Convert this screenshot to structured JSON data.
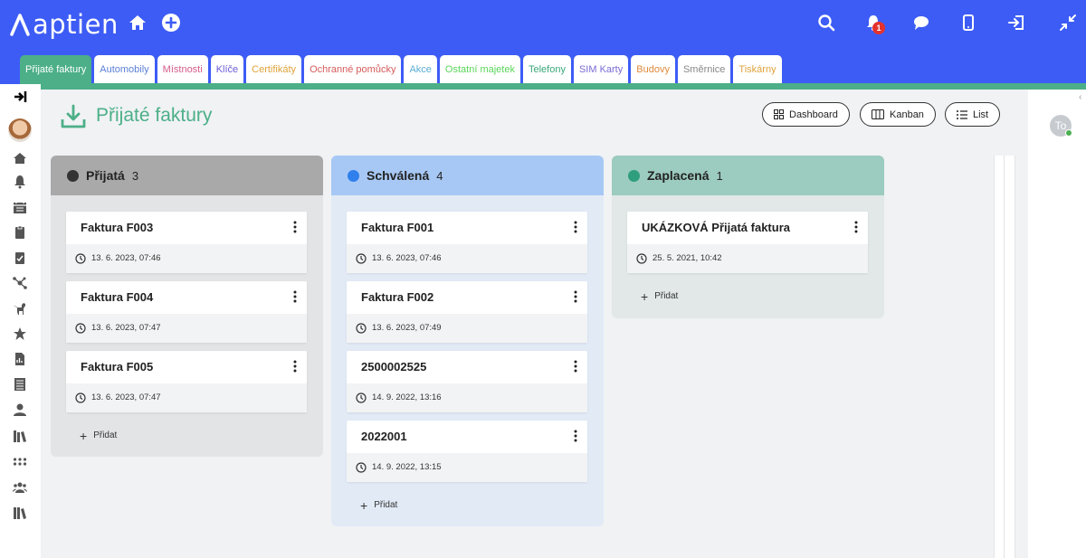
{
  "app": {
    "logo_text": "aptien",
    "notification_count": "1"
  },
  "top_icons": [
    "home-icon",
    "plus-circle-icon",
    "search-icon",
    "bell-icon",
    "chat-icon",
    "mobile-icon",
    "logout-icon",
    "collapse-icon"
  ],
  "tabs": [
    {
      "label": "Přijaté faktury",
      "color": "#ffffff",
      "active": true
    },
    {
      "label": "Automobily",
      "color": "#5b7fd6"
    },
    {
      "label": "Místnosti",
      "color": "#d65b8a"
    },
    {
      "label": "Klíče",
      "color": "#6a5bd6"
    },
    {
      "label": "Certifikáty",
      "color": "#e0a33c"
    },
    {
      "label": "Ochranné pomůcky",
      "color": "#d65b5b"
    },
    {
      "label": "Akce",
      "color": "#5baed6"
    },
    {
      "label": "Ostatní majetek",
      "color": "#5bd65b"
    },
    {
      "label": "Telefony",
      "color": "#3aa87a"
    },
    {
      "label": "SIM Karty",
      "color": "#7a6bd6"
    },
    {
      "label": "Budovy",
      "color": "#e08a3c"
    },
    {
      "label": "Směrnice",
      "color": "#888888"
    },
    {
      "label": "Tiskárny",
      "color": "#e0a33c"
    }
  ],
  "page": {
    "title": "Přijaté faktury"
  },
  "views": {
    "dashboard": "Dashboard",
    "kanban": "Kanban",
    "list": "List"
  },
  "columns": [
    {
      "name": "Přijatá",
      "count": "3",
      "dot_color": "#333333",
      "head_bg": "#a9a9a9",
      "body_bg": "#e3e4e5",
      "cards": [
        {
          "title": "Faktura F003",
          "date": "13. 6. 2023, 07:46"
        },
        {
          "title": "Faktura F004",
          "date": "13. 6. 2023, 07:47"
        },
        {
          "title": "Faktura F005",
          "date": "13. 6. 2023, 07:47"
        }
      ],
      "add_label": "Přidat"
    },
    {
      "name": "Schválená",
      "count": "4",
      "dot_color": "#2f80ed",
      "head_bg": "#a7c8f5",
      "body_bg": "#e2eaf6",
      "cards": [
        {
          "title": "Faktura F001",
          "date": "13. 6. 2023, 07:46"
        },
        {
          "title": "Faktura F002",
          "date": "13. 6. 2023, 07:49"
        },
        {
          "title": "2500002525",
          "date": "14. 9. 2022, 13:16"
        },
        {
          "title": "2022001",
          "date": "14. 9. 2022, 13:15"
        }
      ],
      "add_label": "Přidat"
    },
    {
      "name": "Zaplacená",
      "count": "1",
      "dot_color": "#2e9e7c",
      "head_bg": "#9ccbbf",
      "body_bg": "#e1e8e7",
      "cards": [
        {
          "title": "UKÁZKOVÁ Přijatá faktura",
          "date": "25. 5. 2021, 10:42"
        }
      ],
      "add_label": "Přidat"
    }
  ],
  "sidebar_icons": [
    "expand-icon",
    "avatar",
    "home-icon",
    "bell-icon",
    "calendar-icon",
    "clipboard-icon",
    "clipboard-check-icon",
    "network-icon",
    "dog-icon",
    "star-icon",
    "report-icon",
    "list-icon",
    "user-icon",
    "books-icon",
    "dots-icon",
    "users-icon",
    "archive-icon"
  ],
  "right_panel": {
    "avatar_initials": "To"
  }
}
